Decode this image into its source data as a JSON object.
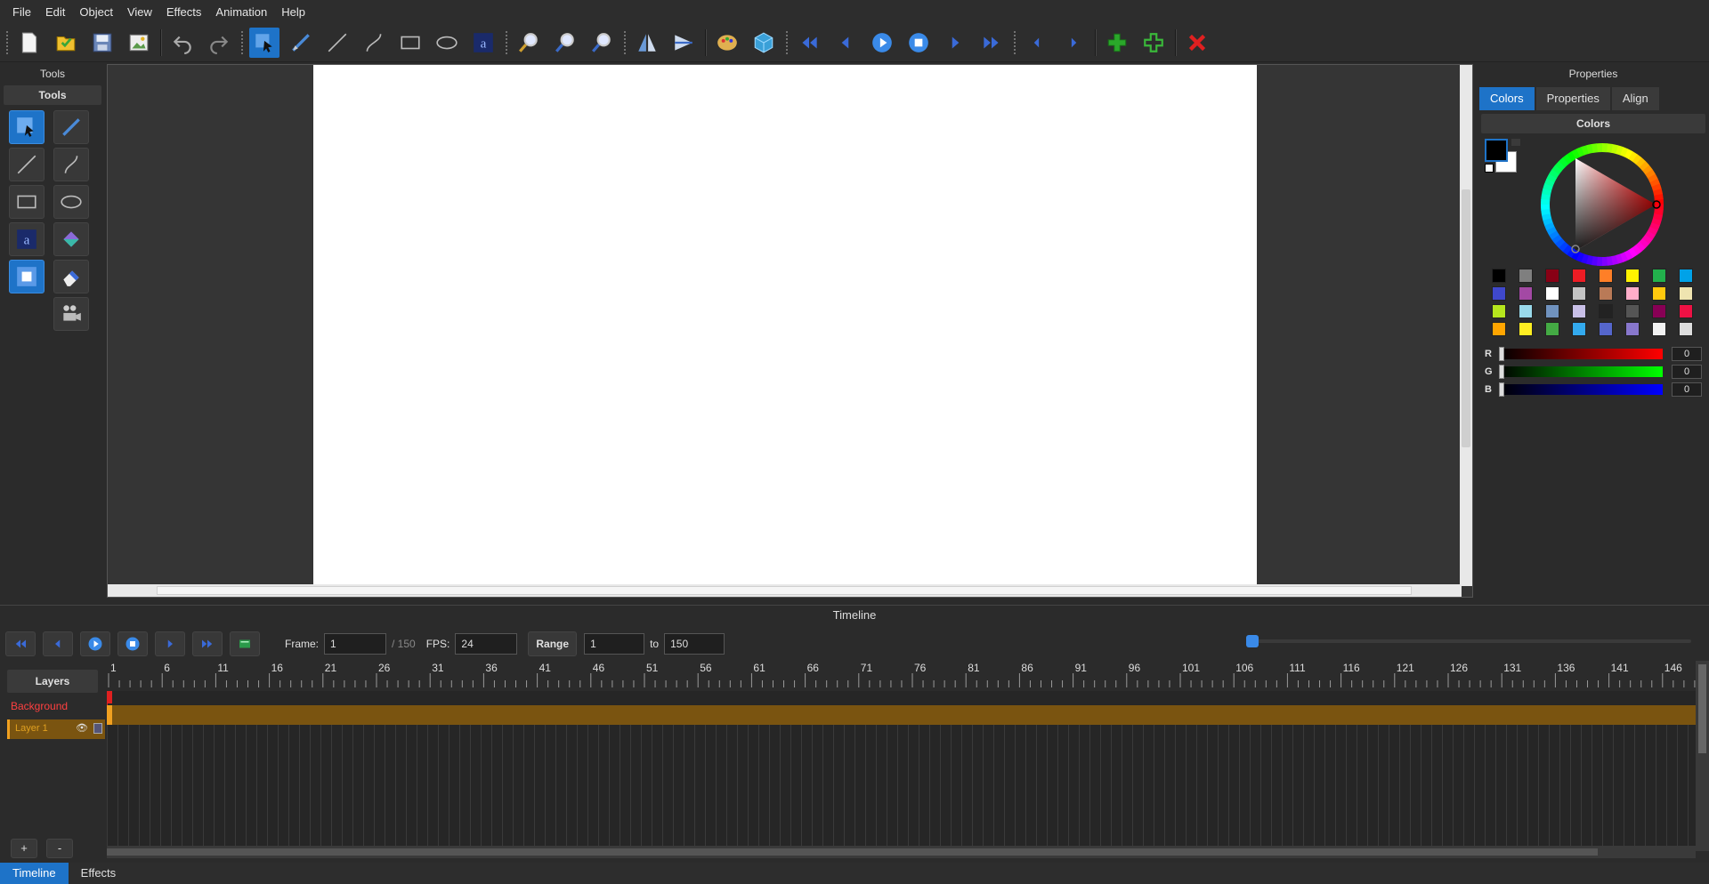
{
  "menu": [
    "File",
    "Edit",
    "Object",
    "View",
    "Effects",
    "Animation",
    "Help"
  ],
  "toolbar": {
    "buttons": [
      "new-file",
      "open-file",
      "save",
      "export",
      "undo",
      "redo",
      "select",
      "pen",
      "line",
      "bezier",
      "rectangle",
      "ellipse",
      "text",
      "zoom-in",
      "zoom-out",
      "zoom-fit",
      "flip",
      "align",
      "palette",
      "3d-cube",
      "first-frame",
      "previous-frame",
      "play",
      "stop",
      "next-frame",
      "last-frame",
      "previous-keyframe",
      "next-keyframe",
      "add-layer",
      "add-frame",
      "delete"
    ]
  },
  "tools_panel": {
    "title": "Tools",
    "subtitle": "Tools"
  },
  "properties_panel": {
    "title": "Properties",
    "tabs": [
      "Colors",
      "Properties",
      "Align"
    ],
    "active_tab": "Colors",
    "section_title": "Colors",
    "swatches": [
      "#000000",
      "#7f7f7f",
      "#880015",
      "#ed1c24",
      "#ff7f27",
      "#fff200",
      "#22b14c",
      "#00a2e8",
      "#3f48cc",
      "#a349a4",
      "#ffffff",
      "#c3c3c3",
      "#b97a57",
      "#ffaec9",
      "#ffc90e",
      "#efe4b0",
      "#b5e61d",
      "#99d9ea",
      "#7092be",
      "#c8bfe7",
      "#222222",
      "#555555",
      "#880055",
      "#ee1144",
      "#ffa500",
      "#ffee22",
      "#44aa44",
      "#33aaee",
      "#5566cc",
      "#8877cc",
      "#f2f2f2",
      "#dddddd"
    ],
    "rgb": [
      {
        "label": "R",
        "value": "0",
        "color": "#ff0000"
      },
      {
        "label": "G",
        "value": "0",
        "color": "#00ff00"
      },
      {
        "label": "B",
        "value": "0",
        "color": "#0000ff"
      }
    ]
  },
  "timeline": {
    "title": "Timeline",
    "frame_label": "Frame:",
    "frame_value": "1",
    "frame_total": "/ 150",
    "fps_label": "FPS:",
    "fps_value": "24",
    "range_label": "Range",
    "range_from": "1",
    "range_to_label": "to",
    "range_to": "150",
    "layers_header": "Layers",
    "layers": [
      {
        "name": "Background",
        "color": "#ff4040"
      },
      {
        "name": "Layer 1",
        "color": "#e0a020"
      }
    ],
    "add_layer": "+",
    "remove_layer": "-",
    "ruler_ticks": [
      "1",
      "6",
      "11",
      "16",
      "21",
      "26",
      "31",
      "36",
      "41",
      "46",
      "51",
      "56",
      "61",
      "66",
      "71",
      "76",
      "81",
      "86",
      "91",
      "96",
      "101",
      "106",
      "111",
      "116",
      "121",
      "126",
      "131",
      "136",
      "141",
      "146"
    ]
  },
  "bottom_tabs": [
    "Timeline",
    "Effects"
  ],
  "colors": {
    "accent": "#1e73c8",
    "layer_row": "#7a5410"
  }
}
